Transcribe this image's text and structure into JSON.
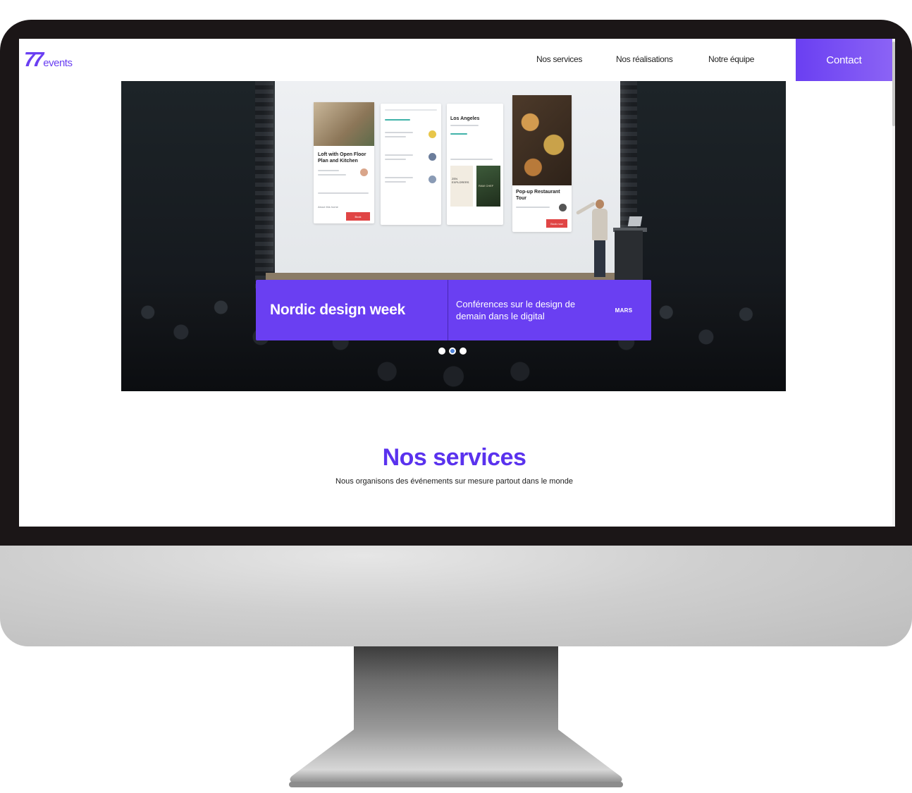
{
  "header": {
    "logo_mark": "77",
    "logo_word": "events",
    "nav": [
      {
        "label": "Nos services"
      },
      {
        "label": "Nos réalisations"
      },
      {
        "label": "Notre équipe"
      }
    ],
    "contact_label": "Contact"
  },
  "hero": {
    "event_title": "Nordic design week",
    "event_description": "Conférences sur le design de demain dans le digital",
    "event_month": "MARS",
    "slides_count": 3,
    "active_slide": 2,
    "screen_cards": {
      "card1_title": "Loft with Open Floor Plan and Kitchen",
      "card3_title": "Los Angeles",
      "card4_title": "Pop-up Restaurant Tour",
      "book_label": "Book",
      "book_now_label": "Book now",
      "about_label": "About this home",
      "zen_label": "ZEN EXPLORERS",
      "raw_label": "RAW CHEF"
    }
  },
  "services": {
    "title": "Nos services",
    "subtitle": "Nous organisons des événements sur mesure partout dans le monde"
  },
  "colors": {
    "accent": "#6a3ff2",
    "title": "#5a32ee",
    "dot_active": "#4e82d8",
    "bezel": "#1b1617"
  }
}
